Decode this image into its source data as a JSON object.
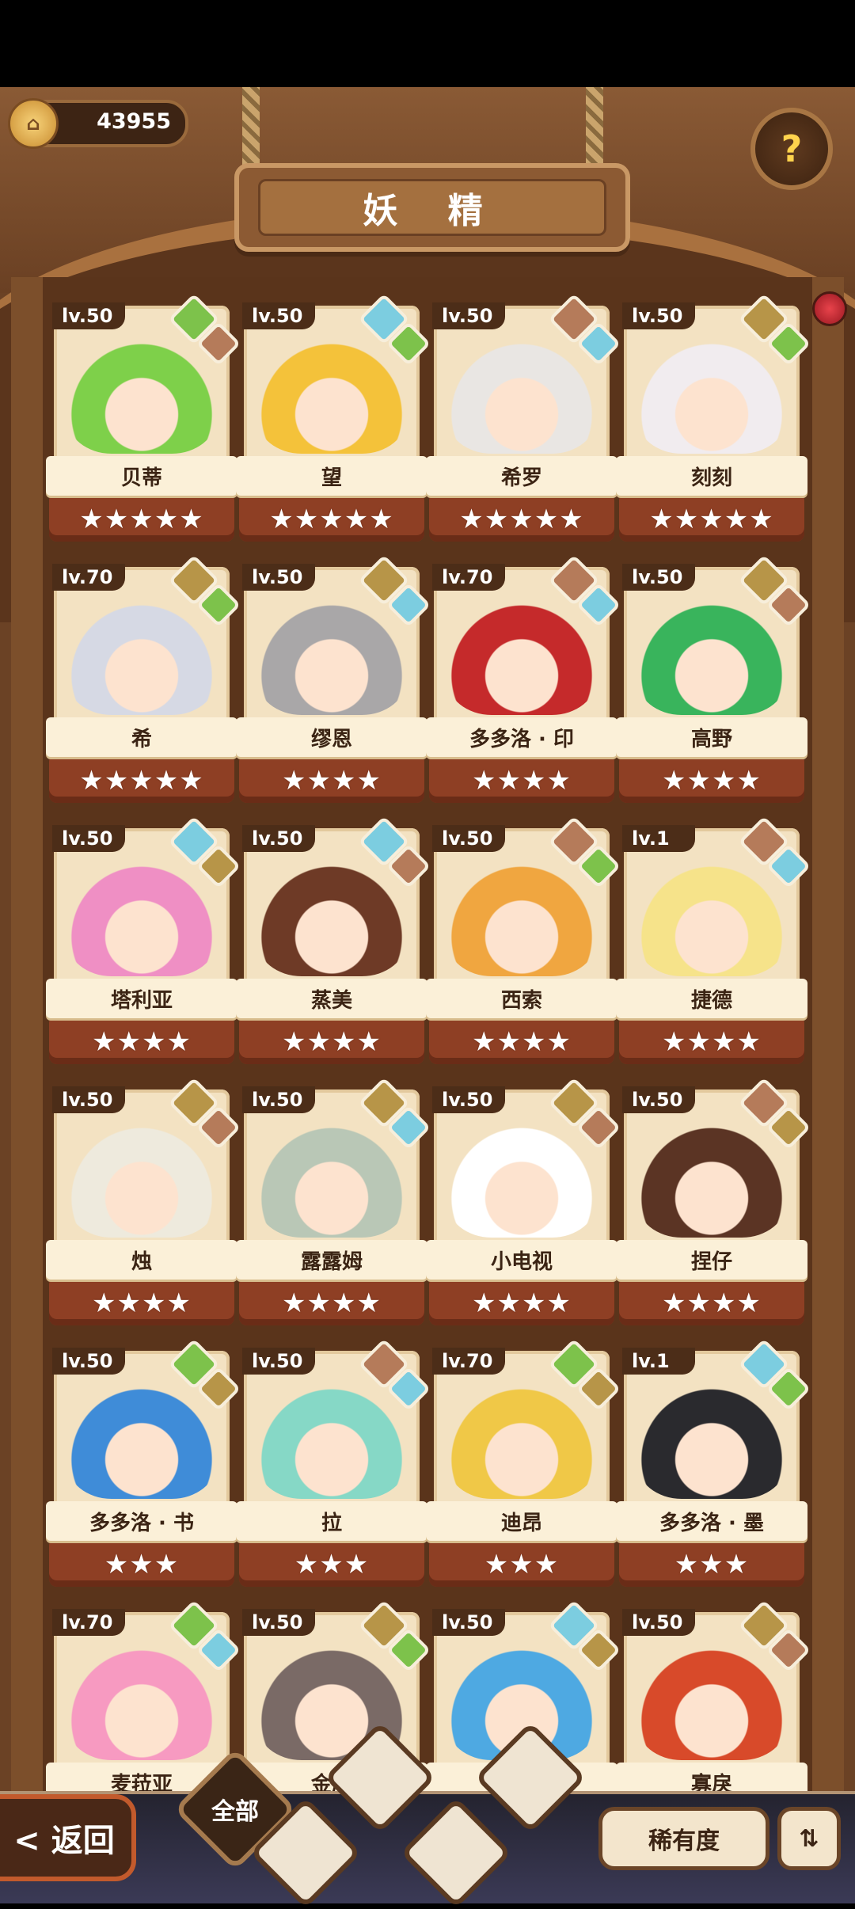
{
  "header": {
    "coins": "43955",
    "title": "妖 精",
    "help_icon": "question-sprout-icon"
  },
  "cards": [
    {
      "level": "lv.50",
      "name": "贝蒂",
      "stars": "★★★★★",
      "elements": [
        "plant",
        "fire"
      ],
      "hair": "#7ed04a"
    },
    {
      "level": "lv.50",
      "name": "望",
      "stars": "★★★★★",
      "elements": [
        "water",
        "plant"
      ],
      "hair": "#f4c23a"
    },
    {
      "level": "lv.50",
      "name": "希罗",
      "stars": "★★★★★",
      "elements": [
        "fire",
        "water"
      ],
      "hair": "#e9e6e3"
    },
    {
      "level": "lv.50",
      "name": "刻刻",
      "stars": "★★★★★",
      "elements": [
        "earth",
        "plant"
      ],
      "hair": "#f1ecef"
    },
    {
      "level": "lv.70",
      "name": "希",
      "stars": "★★★★★",
      "elements": [
        "earth",
        "plant"
      ],
      "hair": "#d6d9e4"
    },
    {
      "level": "lv.50",
      "name": "缪恩",
      "stars": "★★★★",
      "elements": [
        "earth",
        "water"
      ],
      "hair": "#a9a7a8"
    },
    {
      "level": "lv.70",
      "name": "多多洛 · 印",
      "stars": "★★★★",
      "elements": [
        "fire",
        "water"
      ],
      "hair": "#c52a2b"
    },
    {
      "level": "lv.50",
      "name": "高野",
      "stars": "★★★★",
      "elements": [
        "earth",
        "fire"
      ],
      "hair": "#39b45c"
    },
    {
      "level": "lv.50",
      "name": "塔利亚",
      "stars": "★★★★",
      "elements": [
        "water",
        "earth"
      ],
      "hair": "#ef8fc4"
    },
    {
      "level": "lv.50",
      "name": "蒸美",
      "stars": "★★★★",
      "elements": [
        "water",
        "fire"
      ],
      "hair": "#6e3a26"
    },
    {
      "level": "lv.50",
      "name": "西索",
      "stars": "★★★★",
      "elements": [
        "fire",
        "plant"
      ],
      "hair": "#f0a640"
    },
    {
      "level": "lv.1",
      "name": "捷德",
      "stars": "★★★★",
      "elements": [
        "fire",
        "water"
      ],
      "hair": "#f6e38a"
    },
    {
      "level": "lv.50",
      "name": "烛",
      "stars": "★★★★",
      "elements": [
        "earth",
        "fire"
      ],
      "hair": "#eeeadd"
    },
    {
      "level": "lv.50",
      "name": "露露姆",
      "stars": "★★★★",
      "elements": [
        "earth",
        "water"
      ],
      "hair": "#b9c7b6"
    },
    {
      "level": "lv.50",
      "name": "小电视",
      "stars": "★★★★",
      "elements": [
        "earth",
        "fire"
      ],
      "hair": "#ffffff"
    },
    {
      "level": "lv.50",
      "name": "捏仔",
      "stars": "★★★★",
      "elements": [
        "fire",
        "earth"
      ],
      "hair": "#5b3424"
    },
    {
      "level": "lv.50",
      "name": "多多洛 · 书",
      "stars": "★★★",
      "elements": [
        "plant",
        "earth"
      ],
      "hair": "#3f8cd8"
    },
    {
      "level": "lv.50",
      "name": "拉",
      "stars": "★★★",
      "elements": [
        "fire",
        "water"
      ],
      "hair": "#86d8c6"
    },
    {
      "level": "lv.70",
      "name": "迪昂",
      "stars": "★★★",
      "elements": [
        "plant",
        "earth"
      ],
      "hair": "#f0c847"
    },
    {
      "level": "lv.1",
      "name": "多多洛 · 墨",
      "stars": "★★★",
      "elements": [
        "water",
        "plant"
      ],
      "hair": "#2a2a2e"
    },
    {
      "level": "lv.70",
      "name": "麦菈亚",
      "stars": "",
      "elements": [
        "plant",
        "water"
      ],
      "hair": "#f79ac1"
    },
    {
      "level": "lv.50",
      "name": "金库",
      "stars": "",
      "elements": [
        "earth",
        "plant"
      ],
      "hair": "#7a6a66"
    },
    {
      "level": "lv.50",
      "name": "",
      "stars": "",
      "elements": [
        "water",
        "earth"
      ],
      "hair": "#4ea9e2"
    },
    {
      "level": "lv.50",
      "name": "寡戾",
      "stars": "",
      "elements": [
        "earth",
        "fire"
      ],
      "hair": "#d84a2a"
    }
  ],
  "footer": {
    "back_label": "< 返回",
    "all_label": "全部",
    "filters": [
      "water-element-icon",
      "plant-element-icon",
      "earth-element-icon",
      "fire-element-icon"
    ],
    "sort_label": "稀有度",
    "order_icon": "sort-order-icon"
  }
}
